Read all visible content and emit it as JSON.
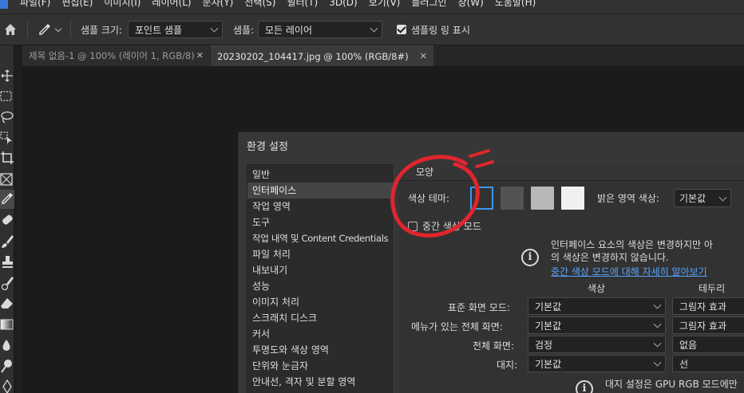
{
  "menu": {
    "items": [
      "파일(F)",
      "편집(E)",
      "이미지(I)",
      "레이어(L)",
      "문자(Y)",
      "선택(S)",
      "필터(T)",
      "3D(D)",
      "보기(V)",
      "플러그인",
      "창(W)",
      "도움말(H)"
    ]
  },
  "options": {
    "sample_size_label": "샘플 크기:",
    "sample_size_value": "포인트 샘플",
    "sample_label": "샘플:",
    "sample_value": "모든 레이어",
    "show_ring_label": "샘플링 링 표시",
    "show_ring_checked": true
  },
  "tabs": [
    {
      "label": "제목 없음-1 @ 100% (레이어 1, RGB/8)",
      "active": false
    },
    {
      "label": "20230202_104417.jpg @ 100% (RGB/8#)",
      "active": true
    }
  ],
  "dialog": {
    "title": "환경 설정",
    "nav": [
      {
        "label": "일반",
        "active": false
      },
      {
        "label": "인터페이스",
        "active": true
      },
      {
        "label": "작업 영역",
        "active": false
      },
      {
        "label": "도구",
        "active": false
      },
      {
        "label": "작업 내역 및 Content Credentials",
        "active": false
      },
      {
        "label": "파일 처리",
        "active": false
      },
      {
        "label": "내보내기",
        "active": false
      },
      {
        "label": "성능",
        "active": false
      },
      {
        "label": "이미지 처리",
        "active": false
      },
      {
        "label": "스크래치 디스크",
        "active": false
      },
      {
        "label": "커서",
        "active": false
      },
      {
        "label": "투명도와 색상 영역",
        "active": false
      },
      {
        "label": "단위와 눈금자",
        "active": false
      },
      {
        "label": "안내선, 격자 및 분할 영역",
        "active": false
      }
    ],
    "appearance": {
      "section_title": "모양",
      "color_theme_label": "색상 테마:",
      "theme_swatches": [
        {
          "name": "darkest",
          "color": "#323232",
          "selected": true
        },
        {
          "name": "dark",
          "color": "#535353",
          "selected": false
        },
        {
          "name": "light",
          "color": "#b8b8b8",
          "selected": false
        },
        {
          "name": "lightest",
          "color": "#f0f0f0",
          "selected": false
        }
      ],
      "highlight_color_label": "밝은 영역 색상:",
      "highlight_color_value": "기본값",
      "medium_gray_label": "중간 색상 모드",
      "medium_gray_checked": false,
      "info_text_1": "인터페이스 요소의 색상은 변경하지만 아",
      "info_text_2": "의 색상은 변경하지 않습니다.",
      "info_link": "중간 색상 모드에 대해 자세히 알아보기",
      "col_color": "색상",
      "col_border": "테두리",
      "rows": [
        {
          "label": "표준 화면 모드:",
          "color": "기본값",
          "border": "그림자 효과"
        },
        {
          "label": "메뉴가 있는 전체 화면:",
          "color": "기본값",
          "border": "그림자 효과"
        },
        {
          "label": "전체 화면:",
          "color": "검정",
          "border": "없음"
        },
        {
          "label": "대지:",
          "color": "기본값",
          "border": "선"
        }
      ],
      "artboard_note": "대지 설정은 GPU RGB 모드에만"
    }
  },
  "annotation": {
    "color": "#e0262d"
  }
}
